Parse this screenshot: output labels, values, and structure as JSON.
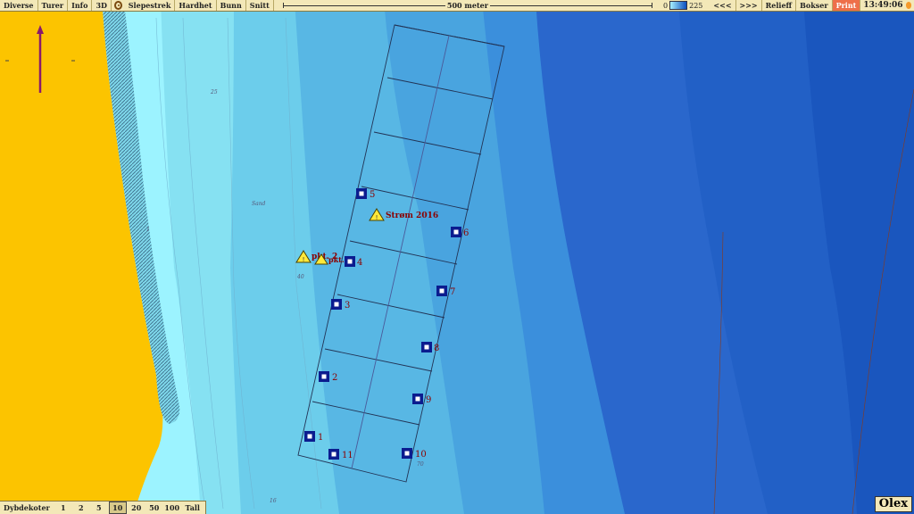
{
  "toolbar": {
    "items": [
      "Diverse",
      "Turer",
      "Info",
      "3D"
    ],
    "items2": [
      "Slepestrek",
      "Hardhet",
      "Bunn",
      "Snitt"
    ],
    "scale_label": "500 meter",
    "depth_min": "0",
    "depth_max": "225",
    "nav_back": "<<<",
    "nav_fwd": ">>>",
    "relief": "Relieff",
    "bokser": "Bokser",
    "print": "Print",
    "time": "13:49:06"
  },
  "bottom": {
    "title": "Dybdekoter",
    "options": [
      "1",
      "2",
      "5",
      "10",
      "20",
      "50",
      "100",
      "Tall"
    ],
    "selected": "10"
  },
  "logo": "Olex",
  "markers": {
    "m1": "1",
    "m2": "2",
    "m3": "3",
    "m4": "4",
    "m5": "5",
    "m6": "6",
    "m7": "7",
    "m8": "8",
    "m9": "9",
    "m10": "10",
    "m11": "11"
  },
  "warnings": {
    "strom": "Strøm 2016",
    "pkt2": "pkt. 2",
    "pkt": "pkt."
  },
  "map_labels": {
    "sand": "Sand",
    "d25": "25",
    "d40": "40",
    "d70": "70",
    "d16": "16",
    "d1": "1"
  },
  "colors": {
    "land": "#fcc400",
    "shallow": "#8ff0ff",
    "deep": "#0d4fbf",
    "marker": "#0b1c8f",
    "marker_text": "#8b0000",
    "toolbar": "#f3e8b8"
  }
}
